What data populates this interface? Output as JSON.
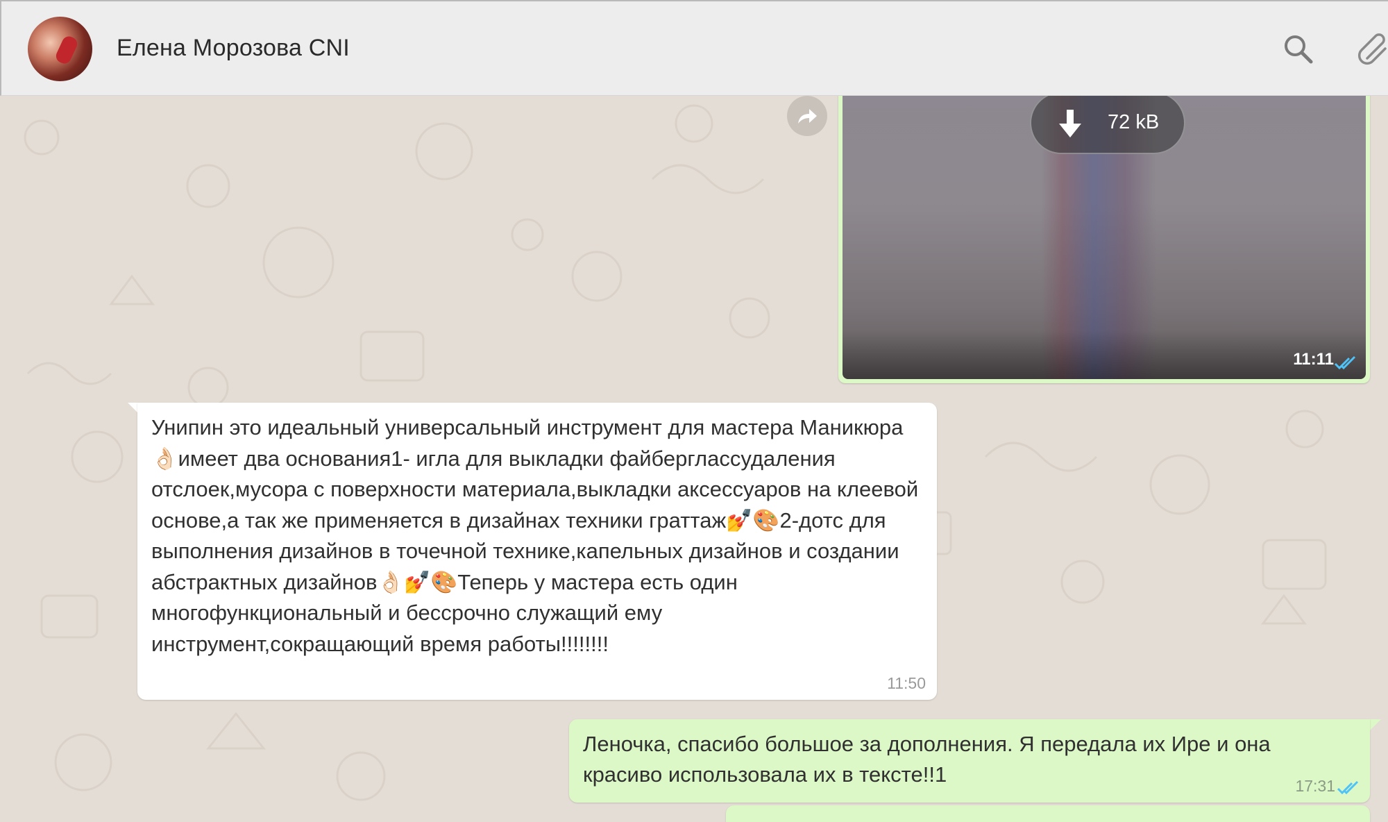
{
  "header": {
    "contact_name": "Елена Морозова CNI",
    "icons": [
      "search-icon",
      "paperclip-icon"
    ]
  },
  "image_message": {
    "download_size": "72 kB",
    "time": "11:11",
    "status": "read",
    "icons": [
      "forward-icon",
      "download-icon",
      "double-check-icon"
    ]
  },
  "incoming_message": {
    "text": "Унипин это идеальный универсальный инструмент для мастера Маникюра 👌🏻имеет два основания1- игла для выкладки файберглассудаления отслоек,мусора с поверхности материала,выкладки аксессуаров на клеевой основе,а так же применяется в дизайнах техники граттаж💅🎨2-дотс для выполнения дизайнов в точечной технике,капельных дизайнов и создании абстрактных дизайнов👌🏻💅🎨Теперь у мастера есть один многофункциональный и бессрочно служащий ему инструмент,сокращающий время работы!!!!!!!!",
    "time": "11:50"
  },
  "outgoing_message": {
    "text": "Леночка, спасибо большое за дополнения. Я передала их Ире и она красиво использовала их в тексте!!1",
    "time": "17:31",
    "status": "read"
  },
  "colors": {
    "chat_background": "#e4ddd5",
    "outgoing_bubble": "#dcf8c6",
    "incoming_bubble": "#ffffff",
    "header_background": "#ededed",
    "read_tick": "#4fc3f7"
  }
}
